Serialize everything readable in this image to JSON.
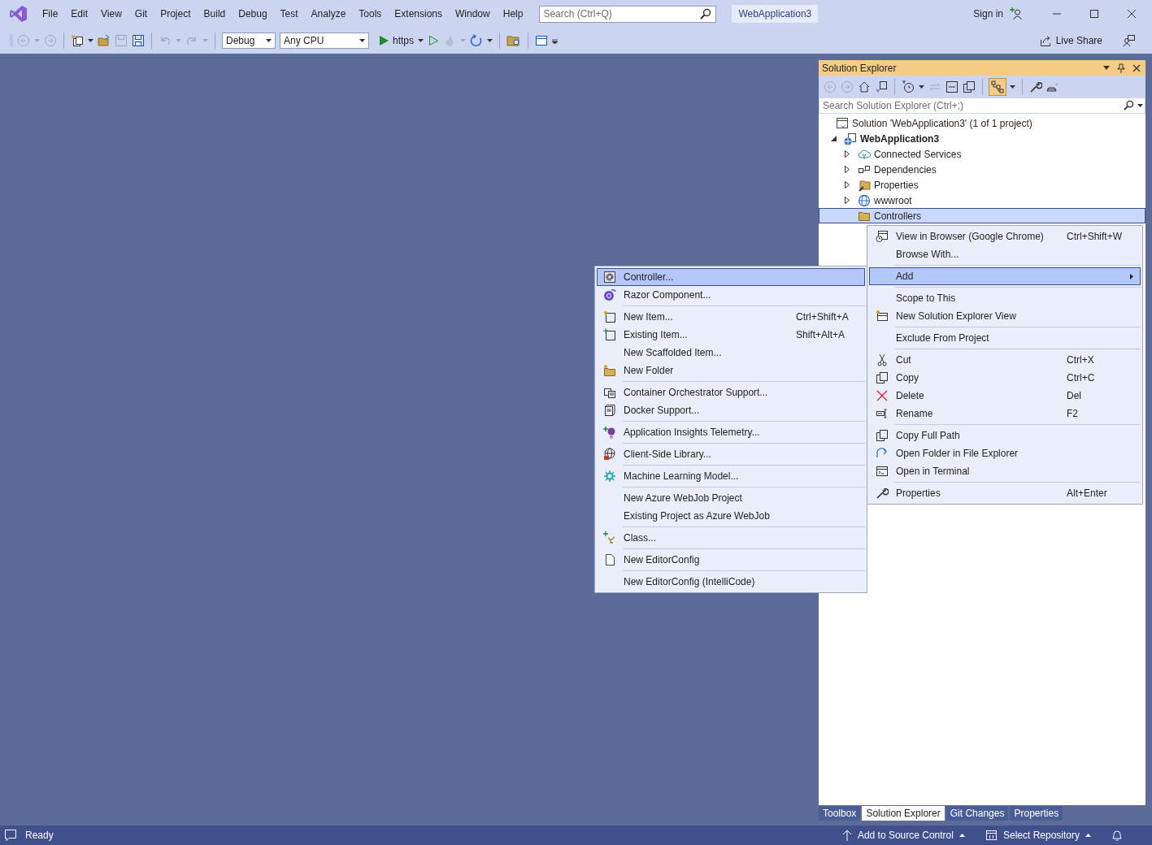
{
  "menu_bar": [
    "File",
    "Edit",
    "View",
    "Git",
    "Project",
    "Build",
    "Debug",
    "Test",
    "Analyze",
    "Tools",
    "Extensions",
    "Window",
    "Help"
  ],
  "search": {
    "placeholder": "Search (Ctrl+Q)"
  },
  "solution_name": "WebApplication3",
  "sign_in": "Sign in",
  "toolbar": {
    "configuration": "Debug",
    "platform": "Any CPU",
    "run_target": "https"
  },
  "live_share": "Live Share",
  "solution_explorer": {
    "title": "Solution Explorer",
    "search": {
      "placeholder": "Search Solution Explorer (Ctrl+;)"
    },
    "tree": [
      {
        "label": "Solution 'WebApplication3' (1 of 1 project)",
        "kind": "solution",
        "selected": false,
        "children": [
          {
            "label": "WebApplication3",
            "kind": "project",
            "expanded": true,
            "selected": false,
            "children": [
              {
                "label": "Connected Services",
                "kind": "services",
                "expanded": false,
                "selected": false
              },
              {
                "label": "Dependencies",
                "kind": "dependencies",
                "expanded": false,
                "selected": false
              },
              {
                "label": "Properties",
                "kind": "properties",
                "expanded": false,
                "selected": false
              },
              {
                "label": "wwwroot",
                "kind": "web",
                "expanded": false,
                "selected": false
              },
              {
                "label": "Controllers",
                "kind": "folder",
                "selected": true
              }
            ]
          }
        ]
      }
    ],
    "tabs": [
      {
        "label": "Toolbox",
        "selected": false
      },
      {
        "label": "Solution Explorer",
        "selected": true
      },
      {
        "label": "Git Changes",
        "selected": false
      },
      {
        "label": "Properties",
        "selected": false
      }
    ]
  },
  "context_menu": {
    "groups": [
      [
        {
          "label": "View in Browser (Google Chrome)",
          "shortcut": "Ctrl+Shift+W",
          "selected": false,
          "submenu": false
        },
        {
          "label": "Browse With...",
          "selected": false,
          "submenu": false
        }
      ],
      [
        {
          "label": "Add",
          "selected": true,
          "submenu": true
        }
      ],
      [
        {
          "label": "Scope to This",
          "selected": false,
          "submenu": false
        },
        {
          "label": "New Solution Explorer View",
          "selected": false,
          "submenu": false
        }
      ],
      [
        {
          "label": "Exclude From Project",
          "selected": false,
          "submenu": false
        }
      ],
      [
        {
          "label": "Cut",
          "shortcut": "Ctrl+X",
          "selected": false,
          "submenu": false
        },
        {
          "label": "Copy",
          "shortcut": "Ctrl+C",
          "selected": false,
          "submenu": false
        },
        {
          "label": "Delete",
          "shortcut": "Del",
          "selected": false,
          "submenu": false
        },
        {
          "label": "Rename",
          "shortcut": "F2",
          "selected": false,
          "submenu": false
        }
      ],
      [
        {
          "label": "Copy Full Path",
          "selected": false,
          "submenu": false
        },
        {
          "label": "Open Folder in File Explorer",
          "selected": false,
          "submenu": false
        },
        {
          "label": "Open in Terminal",
          "selected": false,
          "submenu": false
        }
      ],
      [
        {
          "label": "Properties",
          "shortcut": "Alt+Enter",
          "selected": false,
          "submenu": false
        }
      ]
    ]
  },
  "add_submenu": {
    "groups": [
      [
        {
          "label": "Controller...",
          "selected": true,
          "submenu": false
        },
        {
          "label": "Razor Component...",
          "selected": false,
          "submenu": false
        }
      ],
      [
        {
          "label": "New Item...",
          "shortcut": "Ctrl+Shift+A",
          "selected": false,
          "submenu": false
        },
        {
          "label": "Existing Item...",
          "shortcut": "Shift+Alt+A",
          "selected": false,
          "submenu": false
        },
        {
          "label": "New Scaffolded Item...",
          "selected": false,
          "submenu": false
        },
        {
          "label": "New Folder",
          "selected": false,
          "submenu": false
        }
      ],
      [
        {
          "label": "Container Orchestrator Support...",
          "selected": false,
          "submenu": false
        },
        {
          "label": "Docker Support...",
          "selected": false,
          "submenu": false
        }
      ],
      [
        {
          "label": "Application Insights Telemetry...",
          "selected": false,
          "submenu": false
        }
      ],
      [
        {
          "label": "Client-Side Library...",
          "selected": false,
          "submenu": false
        }
      ],
      [
        {
          "label": "Machine Learning Model...",
          "selected": false,
          "submenu": false
        }
      ],
      [
        {
          "label": "New Azure WebJob Project",
          "selected": false,
          "submenu": false
        },
        {
          "label": "Existing Project as Azure WebJob",
          "selected": false,
          "submenu": false
        }
      ],
      [
        {
          "label": "Class...",
          "selected": false,
          "submenu": false
        }
      ],
      [
        {
          "label": "New EditorConfig",
          "selected": false,
          "submenu": false
        }
      ],
      [
        {
          "label": "New EditorConfig (IntelliCode)",
          "selected": false,
          "submenu": false
        }
      ]
    ]
  },
  "status_bar": {
    "text": "Ready",
    "source_control": "Add to Source Control",
    "repository": "Select Repository"
  }
}
